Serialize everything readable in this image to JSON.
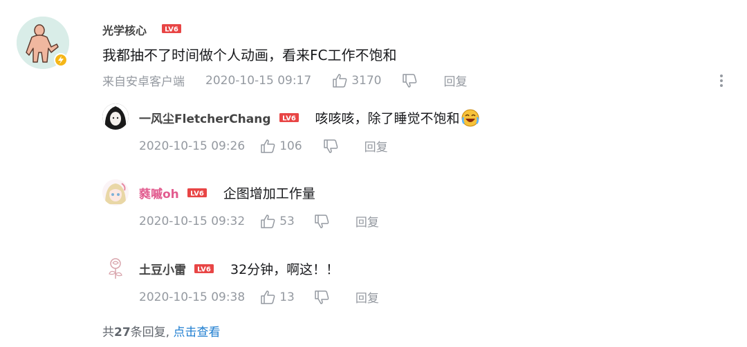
{
  "colors": {
    "text_primary": "#18191c",
    "text_meta": "#9499a0",
    "username_default": "#444444",
    "username_pink": "#e25c8f",
    "link_blue": "#1f7ed0",
    "level_badge_red": "#e84545"
  },
  "main_comment": {
    "username": "光学核心",
    "level": "LV6",
    "text": "我都抽不了时间做个人动画，看来FC工作不饱和",
    "source": "来自安卓客户端",
    "timestamp": "2020-10-15 09:17",
    "likes": "3170",
    "reply_label": "回复",
    "avatar_icon": "character-pointing-avatar",
    "badge_icon": "lightning-badge-icon"
  },
  "replies": [
    {
      "username": "一风尘FletcherChang",
      "level": "LV6",
      "text": "咳咳咳，除了睡觉不饱和",
      "emoji": "laughing-crying-emoji",
      "timestamp": "2020-10-15 09:26",
      "likes": "106",
      "reply_label": "回复"
    },
    {
      "username": "蕤嘁oh",
      "level": "LV6",
      "text": "企图增加工作量",
      "timestamp": "2020-10-15 09:32",
      "likes": "53",
      "reply_label": "回复"
    },
    {
      "username": "土豆小雷",
      "level": "LV6",
      "text": "32分钟，啊这！！",
      "timestamp": "2020-10-15 09:38",
      "likes": "13",
      "reply_label": "回复"
    }
  ],
  "footer": {
    "prefix": "共",
    "count": "27",
    "suffix": "条回复,",
    "view_link": "点击查看"
  }
}
